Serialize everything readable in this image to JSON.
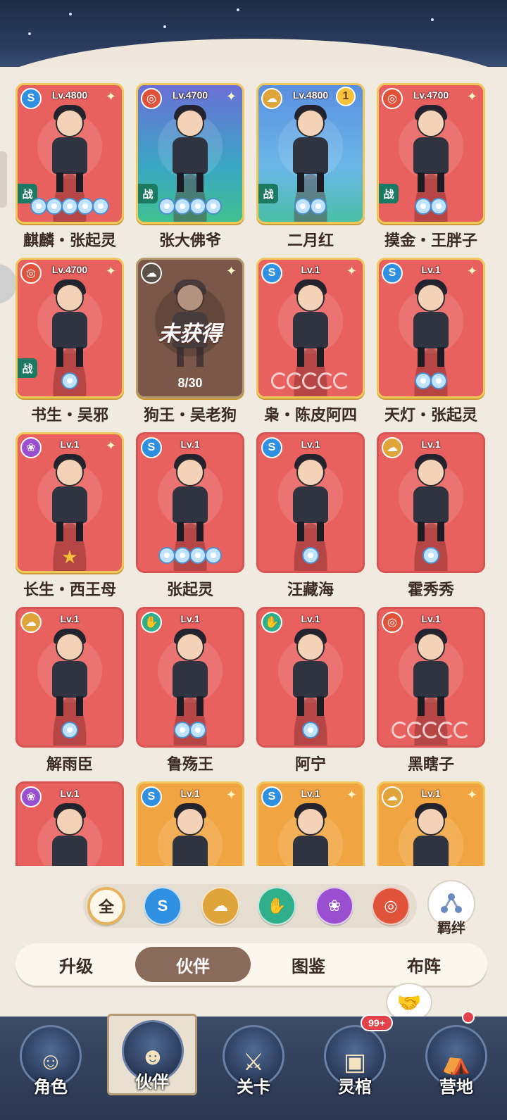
{
  "cards": [
    {
      "name": "麒麟・张起灵",
      "level": "Lv.4800",
      "element": "water",
      "in_team_label": "战",
      "stars": 5,
      "star_type": "gem",
      "variant": "gold-border",
      "bg": "red"
    },
    {
      "name": "张大佛爷",
      "level": "Lv.4700",
      "element": "fire",
      "in_team_label": "战",
      "stars": 4,
      "star_type": "gem",
      "variant": "gold-border",
      "bg": "blue"
    },
    {
      "name": "二月红",
      "level": "Lv.4800",
      "element": "earth",
      "in_team_label": "战",
      "stars": 2,
      "star_type": "gem",
      "variant": "gold-border",
      "bg": "sky",
      "badge": "1"
    },
    {
      "name": "摸金・王胖子",
      "level": "Lv.4700",
      "element": "fire",
      "in_team_label": "战",
      "stars": 2,
      "star_type": "gem",
      "variant": "gold-border",
      "bg": "red"
    },
    {
      "name": "书生・吴邪",
      "level": "Lv.4700",
      "element": "fire",
      "in_team_label": "战",
      "stars": 1,
      "star_type": "gem",
      "variant": "gold-border",
      "bg": "red"
    },
    {
      "name": "狗王・吴老狗",
      "level": "",
      "element": "earth",
      "locked_label": "未获得",
      "progress": "8/30",
      "variant": "locked",
      "bg": "locked"
    },
    {
      "name": "枭・陈皮阿四",
      "level": "Lv.1",
      "element": "water",
      "stars": 5,
      "star_type": "moon",
      "variant": "gold-border",
      "bg": "red"
    },
    {
      "name": "天灯・张起灵",
      "level": "Lv.1",
      "element": "water",
      "stars": 2,
      "star_type": "gem",
      "variant": "gold-border",
      "bg": "red"
    },
    {
      "name": "长生・西王母",
      "level": "Lv.1",
      "element": "lotus",
      "stars": 1,
      "star_type": "star",
      "variant": "gold-border",
      "bg": "red"
    },
    {
      "name": "张起灵",
      "level": "Lv.1",
      "element": "water",
      "stars": 4,
      "star_type": "gem",
      "variant": "plain",
      "bg": "red"
    },
    {
      "name": "汪藏海",
      "level": "Lv.1",
      "element": "water",
      "stars": 1,
      "star_type": "gem",
      "variant": "plain",
      "bg": "red"
    },
    {
      "name": "霍秀秀",
      "level": "Lv.1",
      "element": "earth",
      "stars": 1,
      "star_type": "gem",
      "variant": "plain",
      "bg": "red"
    },
    {
      "name": "解雨臣",
      "level": "Lv.1",
      "element": "earth",
      "stars": 1,
      "star_type": "gem",
      "variant": "plain",
      "bg": "red"
    },
    {
      "name": "鲁殇王",
      "level": "Lv.1",
      "element": "wind",
      "stars": 2,
      "star_type": "gem",
      "variant": "plain",
      "bg": "red"
    },
    {
      "name": "阿宁",
      "level": "Lv.1",
      "element": "wind",
      "stars": 1,
      "star_type": "gem",
      "variant": "plain",
      "bg": "red"
    },
    {
      "name": "黑瞎子",
      "level": "Lv.1",
      "element": "fire",
      "stars": 5,
      "star_type": "moon",
      "variant": "plain",
      "bg": "red"
    },
    {
      "name": "",
      "level": "Lv.1",
      "element": "lotus",
      "variant": "plain",
      "bg": "red"
    },
    {
      "name": "",
      "level": "Lv.1",
      "element": "water",
      "variant": "gold-border",
      "bg": "gold"
    },
    {
      "name": "",
      "level": "Lv.1",
      "element": "water",
      "variant": "gold-border",
      "bg": "gold"
    },
    {
      "name": "",
      "level": "Lv.1",
      "element": "earth",
      "variant": "gold-border",
      "bg": "gold"
    }
  ],
  "filters": [
    {
      "key": "all",
      "label": "全",
      "icon": "all-icon"
    },
    {
      "key": "water",
      "icon": "dragon-icon"
    },
    {
      "key": "earth",
      "icon": "cloud-icon"
    },
    {
      "key": "wind",
      "icon": "palm-icon"
    },
    {
      "key": "lotus",
      "icon": "lotus-icon"
    },
    {
      "key": "fire",
      "icon": "swirl-icon"
    }
  ],
  "bond": {
    "label": "羁绊",
    "icon": "bond-icon"
  },
  "tabs": [
    {
      "label": "升级"
    },
    {
      "label": "伙伴",
      "active": true
    },
    {
      "label": "图鉴"
    },
    {
      "label": "布阵"
    }
  ],
  "bottom_nav": [
    {
      "label": "角色",
      "icon": "character-icon"
    },
    {
      "label": "伙伴",
      "icon": "partner-icon",
      "active": true
    },
    {
      "label": "关卡",
      "icon": "sword-icon"
    },
    {
      "label": "灵棺",
      "icon": "coffin-icon",
      "badge": "99+"
    },
    {
      "label": "营地",
      "icon": "tent-icon",
      "dot": true
    }
  ],
  "colors": {
    "card_red": "#e8615f",
    "card_gold_border": "#f0c85a",
    "active_tab": "#8a6a5a",
    "nav_bg": "#2b3752"
  }
}
